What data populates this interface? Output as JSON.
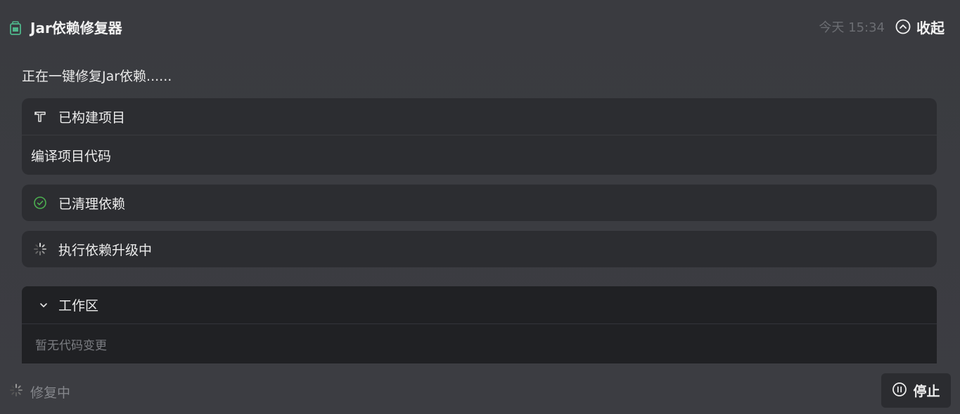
{
  "header": {
    "title": "Jar依赖修复器",
    "timestamp": "今天 15:34",
    "collapse_label": "收起",
    "icon": "jar-icon"
  },
  "status_line": "正在一键修复Jar依赖......",
  "steps": [
    {
      "label": "已构建项目",
      "icon": "hammer-icon",
      "detail": "编译项目代码"
    },
    {
      "label": "已清理依赖",
      "icon": "check-circle-icon",
      "icon_color": "#4caf50"
    },
    {
      "label": "执行依赖升级中",
      "icon": "spinner-icon"
    }
  ],
  "workspace": {
    "title": "工作区",
    "empty_text": "暂无代码变更"
  },
  "footer": {
    "status": "修复中",
    "stop_label": "停止"
  }
}
